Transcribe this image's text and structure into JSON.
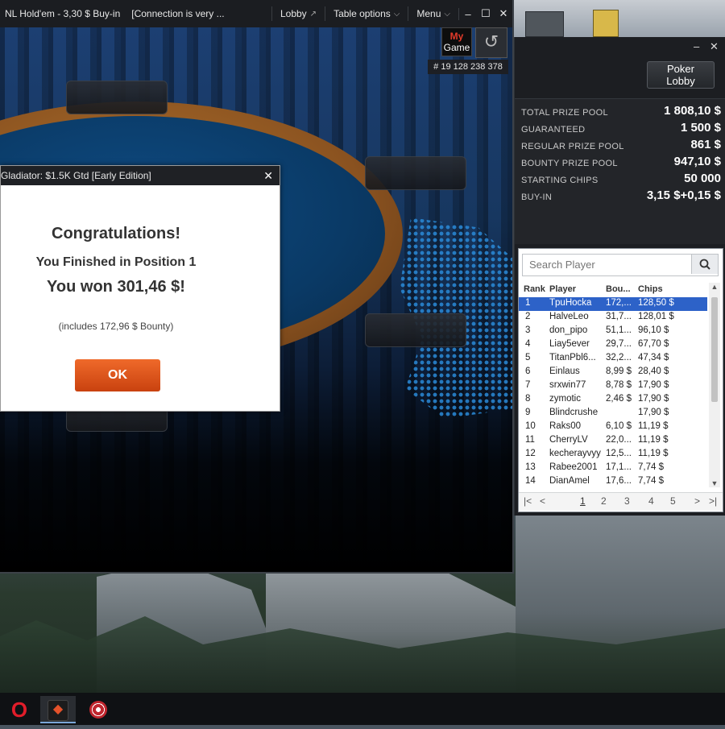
{
  "table_window": {
    "title": "NL  Hold'em - 3,30 $ Buy-in",
    "status": "[Connection is very ...",
    "lobby": "Lobby",
    "table_options": "Table options",
    "menu": "Menu",
    "my_game_top": "My",
    "my_game_bottom": "Game",
    "hand_id": "# 19 128 238 378"
  },
  "dialog": {
    "title": "Gladiator: $1.5K Gtd [Early Edition]",
    "congrats": "Congratulations!",
    "position": "You Finished in Position 1",
    "won": "You won 301,46 $!",
    "bounty": "(includes 172,96 $ Bounty)",
    "ok": "OK"
  },
  "info_panel": {
    "lobby_button": "Poker Lobby",
    "prizes": [
      {
        "label": "TOTAL PRIZE POOL",
        "value": "1 808,10 $"
      },
      {
        "label": "GUARANTEED",
        "value": "1 500 $"
      },
      {
        "label": "REGULAR PRIZE POOL",
        "value": "861 $"
      },
      {
        "label": "BOUNTY PRIZE POOL",
        "value": "947,10 $"
      },
      {
        "label": "STARTING CHIPS",
        "value": "50 000"
      },
      {
        "label": "BUY-IN",
        "value": "3,15 $+0,15 $"
      }
    ],
    "search_placeholder": "Search Player",
    "columns": {
      "rank": "Rank",
      "player": "Player",
      "bounty": "Bou...",
      "chips": "Chips"
    },
    "players": [
      {
        "rank": "1",
        "player": "TpuHocka",
        "bounty": "172,...",
        "chips": "128,50 $"
      },
      {
        "rank": "2",
        "player": "HalveLeo",
        "bounty": "31,7...",
        "chips": "128,01 $"
      },
      {
        "rank": "3",
        "player": "don_pipo",
        "bounty": "51,1...",
        "chips": "96,10 $"
      },
      {
        "rank": "4",
        "player": "Liay5ever",
        "bounty": "29,7...",
        "chips": "67,70 $"
      },
      {
        "rank": "5",
        "player": "TitanPbl6...",
        "bounty": "32,2...",
        "chips": "47,34 $"
      },
      {
        "rank": "6",
        "player": "Einlaus",
        "bounty": "8,99 $",
        "chips": "28,40 $"
      },
      {
        "rank": "7",
        "player": "srxwin77",
        "bounty": "8,78 $",
        "chips": "17,90 $"
      },
      {
        "rank": "8",
        "player": "zymotic",
        "bounty": "2,46 $",
        "chips": "17,90 $"
      },
      {
        "rank": "9",
        "player": "Blindcrushe",
        "bounty": "",
        "chips": "17,90 $"
      },
      {
        "rank": "10",
        "player": "Raks00",
        "bounty": "6,10 $",
        "chips": "11,19 $"
      },
      {
        "rank": "11",
        "player": "CherryLV",
        "bounty": "22,0...",
        "chips": "11,19 $"
      },
      {
        "rank": "12",
        "player": "kecherayvyy",
        "bounty": "12,5...",
        "chips": "11,19 $"
      },
      {
        "rank": "13",
        "player": "Rabee2001",
        "bounty": "17,1...",
        "chips": "7,74 $"
      },
      {
        "rank": "14",
        "player": "DianAmel",
        "bounty": "17,6...",
        "chips": "7,74 $"
      }
    ],
    "pages": [
      "1",
      "2",
      "3",
      "4",
      "5"
    ],
    "selected_color": "#2d62c8"
  },
  "taskbar": {
    "items": [
      "opera-icon",
      "pokerstars-icon",
      "poker-chip-icon"
    ]
  }
}
